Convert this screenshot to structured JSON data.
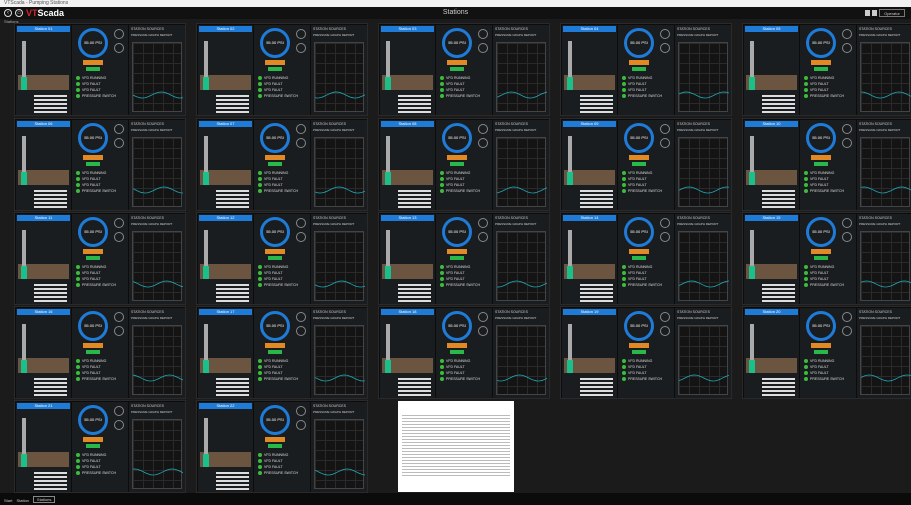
{
  "window": {
    "title": "VTScada - Pumping Stations"
  },
  "app": {
    "logo_prefix": "VT",
    "logo_suffix": "Scada",
    "page_title": "Stations",
    "breadcrumb": "Stations",
    "user": "Operator"
  },
  "panel_labels": {
    "sources": "STATION SOURCES",
    "graph": "PRESSURE GRAPH REPORT",
    "leds": [
      "VFD RUNNING",
      "VFD FAULT",
      "VFD FAULT",
      "PRESSURE SWITCH"
    ],
    "pressure": "55.00 PSI"
  },
  "stations": [
    "Station 01",
    "Station 02",
    "Station 03",
    "Station 04",
    "Station 05",
    "Station 06",
    "Station 07",
    "Station 08",
    "Station 09",
    "Station 10",
    "Station 11",
    "Station 12",
    "Station 13",
    "Station 14",
    "Station 15",
    "Station 16",
    "Station 17",
    "Station 18",
    "Station 19",
    "Station 20",
    "Station 21",
    "Station 22"
  ],
  "taskbar": {
    "start": "Start",
    "items": [
      "Station",
      "Stations"
    ]
  }
}
